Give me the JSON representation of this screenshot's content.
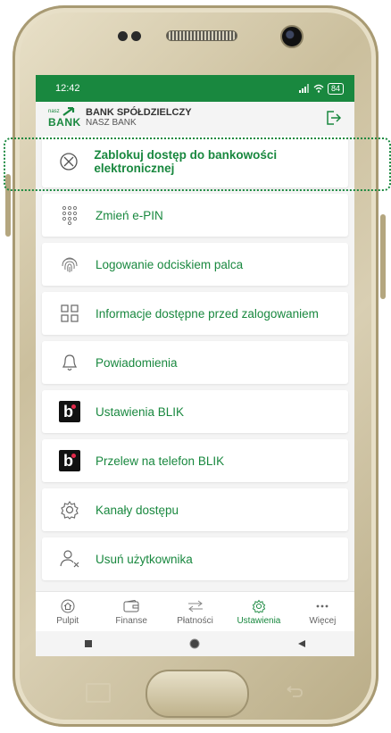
{
  "status": {
    "time": "12:42",
    "battery": "84"
  },
  "header": {
    "logo_small": "nasz",
    "logo_big": "BANK",
    "name_line1": "BANK SPÓŁDZIELCZY",
    "name_line2": "NASZ BANK"
  },
  "menu": [
    {
      "label": "Zablokuj dostęp do bankowości elektronicznej",
      "icon": "block-icon"
    },
    {
      "label": "Zmień e-PIN",
      "icon": "keypad-icon"
    },
    {
      "label": "Logowanie odciskiem palca",
      "icon": "fingerprint-icon"
    },
    {
      "label": "Informacje dostępne przed zalogowaniem",
      "icon": "grid-icon"
    },
    {
      "label": "Powiadomienia",
      "icon": "bell-icon"
    },
    {
      "label": "Ustawienia BLIK",
      "icon": "blik-icon"
    },
    {
      "label": "Przelew na telefon BLIK",
      "icon": "blik-icon"
    },
    {
      "label": "Kanały dostępu",
      "icon": "gear-icon"
    },
    {
      "label": "Usuń użytkownika",
      "icon": "remove-user-icon"
    }
  ],
  "nav": [
    {
      "label": "Pulpit",
      "icon": "home-icon"
    },
    {
      "label": "Finanse",
      "icon": "wallet-icon"
    },
    {
      "label": "Płatności",
      "icon": "transfer-arrows-icon"
    },
    {
      "label": "Ustawienia",
      "icon": "gear-icon"
    },
    {
      "label": "Więcej",
      "icon": "more-dots-icon"
    }
  ],
  "colors": {
    "brand": "#19883f",
    "blik_dot": "#e4294b"
  }
}
